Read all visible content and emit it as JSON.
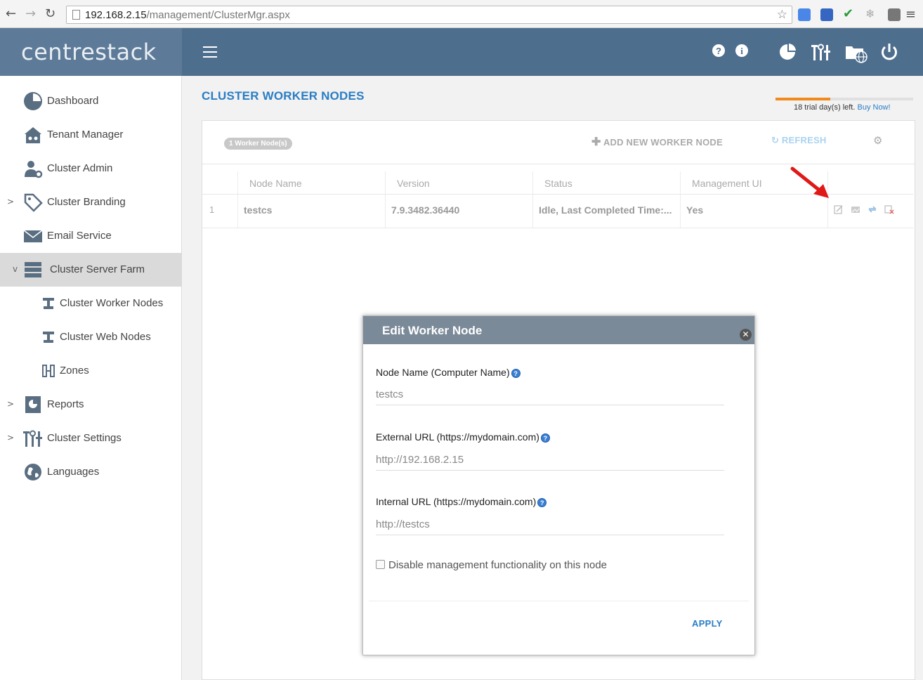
{
  "browser": {
    "url_host": "192.168.2.15",
    "url_path": "/management/ClusterMgr.aspx"
  },
  "app": {
    "logo": "centrestack"
  },
  "sidebar": {
    "items": [
      {
        "label": "Dashboard"
      },
      {
        "label": "Tenant Manager"
      },
      {
        "label": "Cluster Admin"
      },
      {
        "label": "Cluster Branding"
      },
      {
        "label": "Email Service"
      },
      {
        "label": "Cluster Server Farm"
      },
      {
        "label": "Cluster Worker Nodes"
      },
      {
        "label": "Cluster Web Nodes"
      },
      {
        "label": "Zones"
      },
      {
        "label": "Reports"
      },
      {
        "label": "Cluster Settings"
      },
      {
        "label": "Languages"
      }
    ]
  },
  "page": {
    "title": "CLUSTER WORKER NODES",
    "trial_text": "18 trial day(s) left.",
    "buy_now": "Buy Now!",
    "trial_progress": 0.4
  },
  "toolbar": {
    "badge": "1 Worker Node(s)",
    "add_label": "ADD NEW WORKER NODE",
    "refresh_label": "REFRESH"
  },
  "grid": {
    "columns": [
      "Node Name",
      "Version",
      "Status",
      "Management UI"
    ],
    "rows": [
      {
        "num": "1",
        "node_name": "testcs",
        "version": "7.9.3482.36440",
        "status": "Idle, Last Completed Time:...",
        "management_ui": "Yes"
      }
    ]
  },
  "modal": {
    "title": "Edit Worker Node",
    "node_name_label": "Node Name (Computer Name)",
    "node_name_value": "testcs",
    "external_url_label": "External URL (https://mydomain.com)",
    "external_url_value": "http://192.168.2.15",
    "internal_url_label": "Internal URL (https://mydomain.com)",
    "internal_url_value": "http://testcs",
    "disable_label": "Disable management functionality on this node",
    "apply_label": "APPLY"
  },
  "colors": {
    "header": "#4e6e8e",
    "logo_bg": "#5d7b98",
    "accent": "#2a7dc4",
    "trial": "#f08a1c"
  }
}
